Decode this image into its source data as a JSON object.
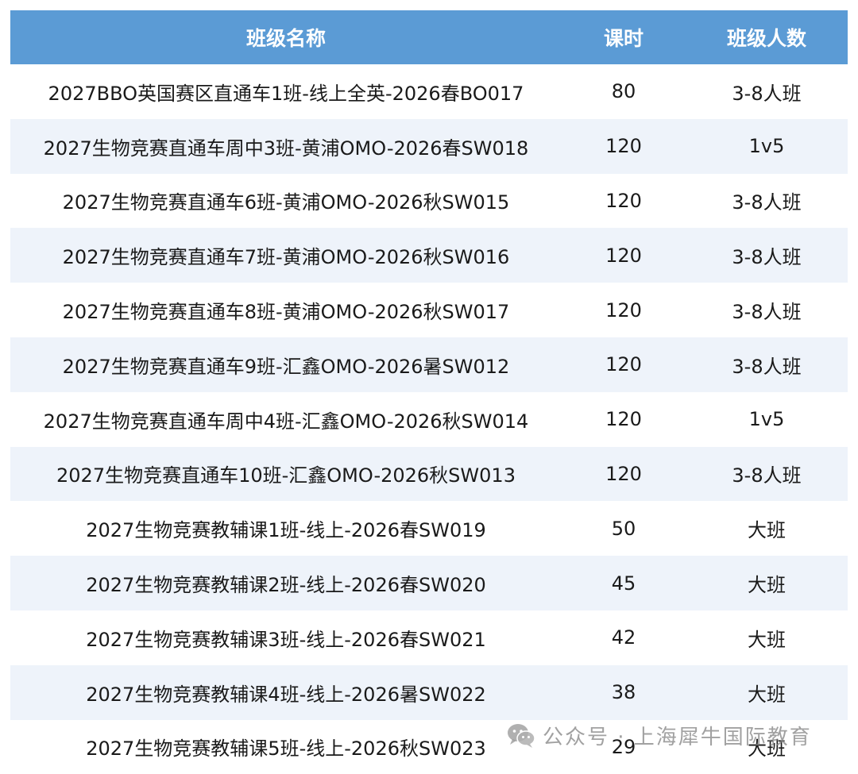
{
  "table": {
    "headers": {
      "name": "班级名称",
      "hours": "课时",
      "size": "班级人数"
    },
    "rows": [
      {
        "name": "2027BBO英国赛区直通车1班-线上全英-2026春BO017",
        "hours": "80",
        "size": "3-8人班"
      },
      {
        "name": "2027生物竞赛直通车周中3班-黄浦OMO-2026春SW018",
        "hours": "120",
        "size": "1v5"
      },
      {
        "name": "2027生物竞赛直通车6班-黄浦OMO-2026秋SW015",
        "hours": "120",
        "size": "3-8人班"
      },
      {
        "name": "2027生物竞赛直通车7班-黄浦OMO-2026秋SW016",
        "hours": "120",
        "size": "3-8人班"
      },
      {
        "name": "2027生物竞赛直通车8班-黄浦OMO-2026秋SW017",
        "hours": "120",
        "size": "3-8人班"
      },
      {
        "name": "2027生物竞赛直通车9班-汇鑫OMO-2026暑SW012",
        "hours": "120",
        "size": "3-8人班"
      },
      {
        "name": "2027生物竞赛直通车周中4班-汇鑫OMO-2026秋SW014",
        "hours": "120",
        "size": "1v5"
      },
      {
        "name": "2027生物竞赛直通车10班-汇鑫OMO-2026秋SW013",
        "hours": "120",
        "size": "3-8人班"
      },
      {
        "name": "2027生物竞赛教辅课1班-线上-2026春SW019",
        "hours": "50",
        "size": "大班"
      },
      {
        "name": "2027生物竞赛教辅课2班-线上-2026春SW020",
        "hours": "45",
        "size": "大班"
      },
      {
        "name": "2027生物竞赛教辅课3班-线上-2026春SW021",
        "hours": "42",
        "size": "大班"
      },
      {
        "name": "2027生物竞赛教辅课4班-线上-2026暑SW022",
        "hours": "38",
        "size": "大班"
      },
      {
        "name": "2027生物竞赛教辅课5班-线上-2026秋SW023",
        "hours": "29",
        "size": "大班"
      }
    ]
  },
  "watermark": {
    "icon": "wechat-icon",
    "text": "公众号 · 上海犀牛国际教育"
  },
  "colors": {
    "header_bg": "#5b9bd5",
    "header_text": "#ffffff",
    "alt_row_bg": "#eef3fa"
  }
}
